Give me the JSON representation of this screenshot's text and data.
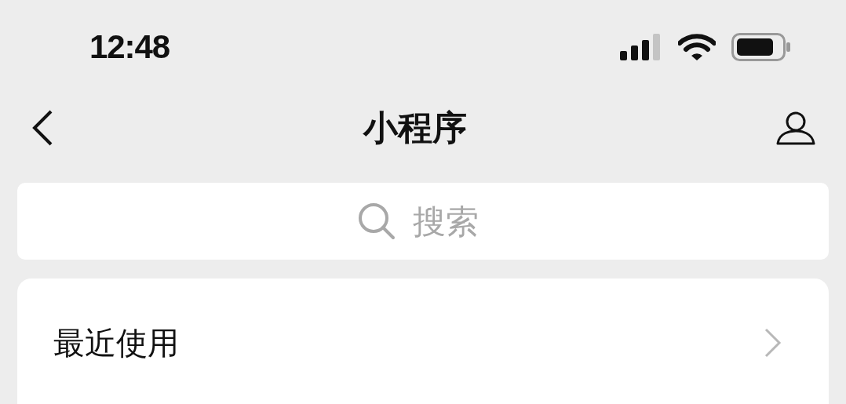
{
  "status_bar": {
    "time": "12:48"
  },
  "nav_bar": {
    "title": "小程序"
  },
  "search": {
    "placeholder": "搜索"
  },
  "sections": [
    {
      "label": "最近使用"
    }
  ]
}
